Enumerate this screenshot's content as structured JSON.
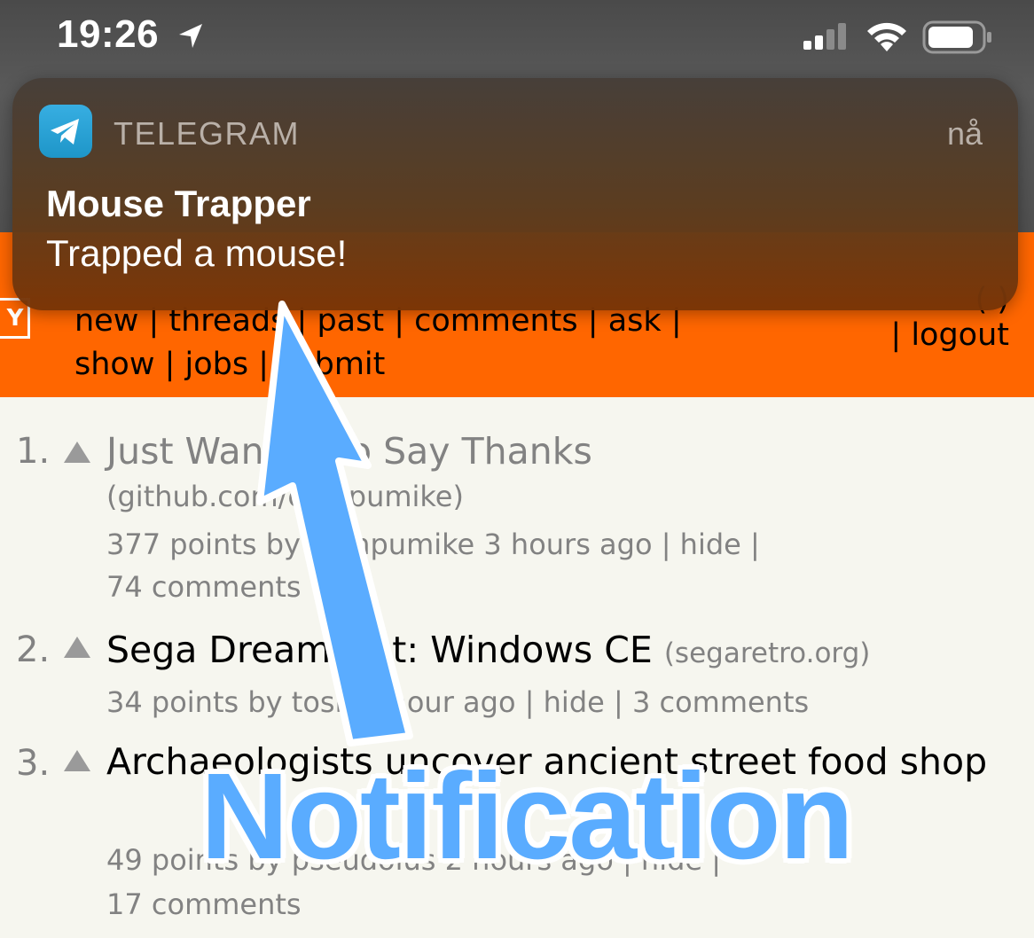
{
  "status_bar": {
    "time": "19:26",
    "icons": [
      "location-arrow-icon",
      "cellular-signal-icon",
      "wifi-icon",
      "battery-icon"
    ]
  },
  "notification": {
    "app_name": "TELEGRAM",
    "time": "nå",
    "title": "Mouse Trapper",
    "body": "Trapped a mouse!",
    "icon": "telegram-icon"
  },
  "header": {
    "logo": "Y",
    "nav_line1": [
      "new",
      "threads",
      "past",
      "comments",
      "ask"
    ],
    "nav_line2": [
      "show",
      "jobs",
      "submit"
    ],
    "right_partial": "(  )",
    "logout": "logout",
    "accent": "#ff6600"
  },
  "stories": [
    {
      "rank": "1.",
      "title": "Just Wanted to Say Thanks",
      "site": "(github.com/compumike)",
      "points": "377 points by compumike 3 hours ago",
      "hide": "hide",
      "comments": "74 comments"
    },
    {
      "rank": "2.",
      "title": "Sega Dreamcast: Windows CE",
      "site": "(segaretro.org)",
      "points": "34 points by tosh 1 hour ago",
      "hide": "hide",
      "comments": "3 comments"
    },
    {
      "rank": "3.",
      "title": "Archaeologists uncover ancient street food shop",
      "site": "",
      "points": "49 points by pseudolus 2 hours ago",
      "hide": "hide",
      "comments": "17 comments"
    }
  ],
  "annotation": {
    "label": "Notification",
    "color": "#5aacff"
  }
}
